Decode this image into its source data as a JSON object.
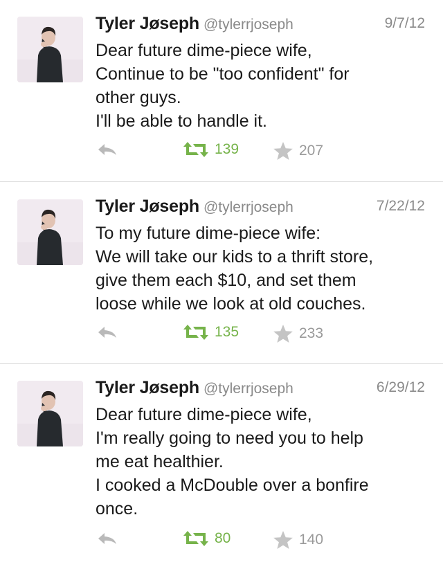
{
  "tweets": [
    {
      "name": "Tyler Jøseph",
      "handle": "@tylerrjoseph",
      "date": "9/7/12",
      "lines": [
        "Dear future dime-piece wife,",
        "Continue to be \"too confident\" for",
        "other guys.",
        "I'll be able to handle it."
      ],
      "retweets": "139",
      "favorites": "207"
    },
    {
      "name": "Tyler Jøseph",
      "handle": "@tylerrjoseph",
      "date": "7/22/12",
      "lines": [
        "To my future dime-piece wife:",
        "We will take our kids to a thrift store,",
        "give them each $10, and set them",
        "loose while we look at old couches."
      ],
      "retweets": "135",
      "favorites": "233"
    },
    {
      "name": "Tyler Jøseph",
      "handle": "@tylerrjoseph",
      "date": "6/29/12",
      "lines": [
        "Dear future dime-piece wife,",
        "I'm really going to need you to help",
        "me eat healthier.",
        "I cooked a McDouble over a bonfire",
        "once."
      ],
      "retweets": "80",
      "favorites": "140"
    }
  ],
  "icons": {
    "reply": "reply-arrow-icon",
    "retweet": "retweet-icon",
    "favorite": "star-icon"
  },
  "colors": {
    "retweet_green": "#76b34a",
    "meta_gray": "#8a8a8a",
    "divider": "#dcdcdc"
  }
}
